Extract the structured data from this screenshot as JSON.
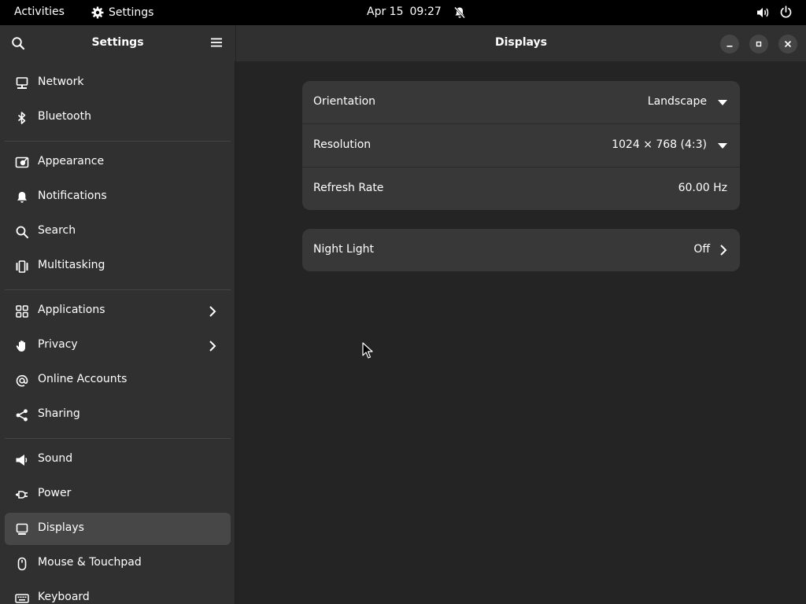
{
  "topbar": {
    "activities": "Activities",
    "app_name": "Settings",
    "date": "Apr 15",
    "time": "09:27"
  },
  "sidebar": {
    "title": "Settings",
    "items": [
      {
        "label": "Network",
        "icon": "network-icon"
      },
      {
        "label": "Bluetooth",
        "icon": "bluetooth-icon"
      },
      {
        "label": "Appearance",
        "icon": "appearance-icon"
      },
      {
        "label": "Notifications",
        "icon": "bell-icon"
      },
      {
        "label": "Search",
        "icon": "search-icon"
      },
      {
        "label": "Multitasking",
        "icon": "multitasking-icon"
      },
      {
        "label": "Applications",
        "icon": "grid-icon"
      },
      {
        "label": "Privacy",
        "icon": "hand-icon"
      },
      {
        "label": "Online Accounts",
        "icon": "at-icon"
      },
      {
        "label": "Sharing",
        "icon": "share-icon"
      },
      {
        "label": "Sound",
        "icon": "speaker-icon"
      },
      {
        "label": "Power",
        "icon": "power-plug-icon"
      },
      {
        "label": "Displays",
        "icon": "display-icon",
        "selected": true
      },
      {
        "label": "Mouse & Touchpad",
        "icon": "mouse-icon"
      },
      {
        "label": "Keyboard",
        "icon": "keyboard-icon"
      }
    ]
  },
  "content": {
    "title": "Displays",
    "display_settings": [
      {
        "label": "Orientation",
        "value": "Landscape"
      },
      {
        "label": "Resolution",
        "value": "1024 × 768 (4:3)"
      },
      {
        "label": "Refresh Rate",
        "value": "60.00 Hz"
      }
    ],
    "night_light": {
      "label": "Night Light",
      "value": "Off"
    }
  },
  "colors": {
    "background": "#242424",
    "sidebar": "#303030",
    "card": "#383838",
    "selected": "#474747"
  }
}
